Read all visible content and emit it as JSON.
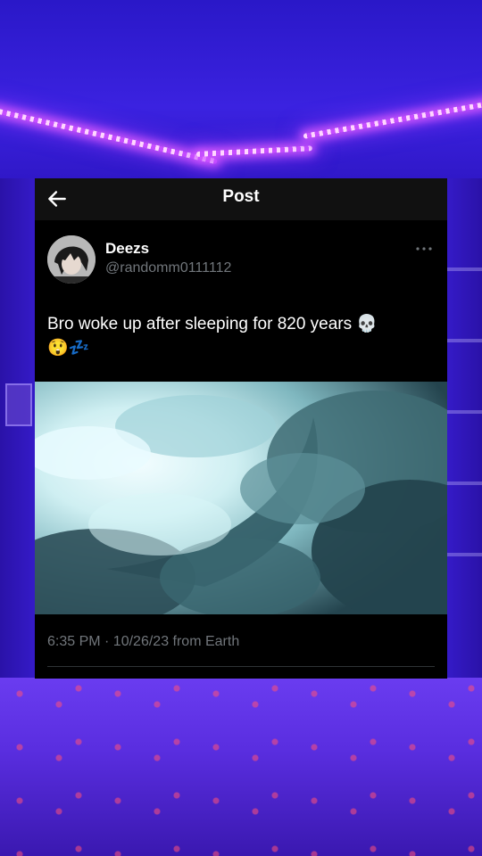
{
  "header": {
    "title": "Post"
  },
  "author": {
    "display_name": "Deezs",
    "handle": "@randomm0111112"
  },
  "post": {
    "text": "Bro woke up after sleeping for 820 years 💀",
    "emoji_line": "😲💤",
    "timestamp_line": "6:35 PM · 10/26/23 from Earth"
  },
  "colors": {
    "card_background": "#000000",
    "topbar_background": "#111111",
    "secondary_text": "#71767b",
    "primary_text": "#ffffff",
    "background_purple": "#3a1fd8"
  },
  "icons": {
    "back": "arrow-left-icon",
    "more": "more-horizontal-icon"
  }
}
